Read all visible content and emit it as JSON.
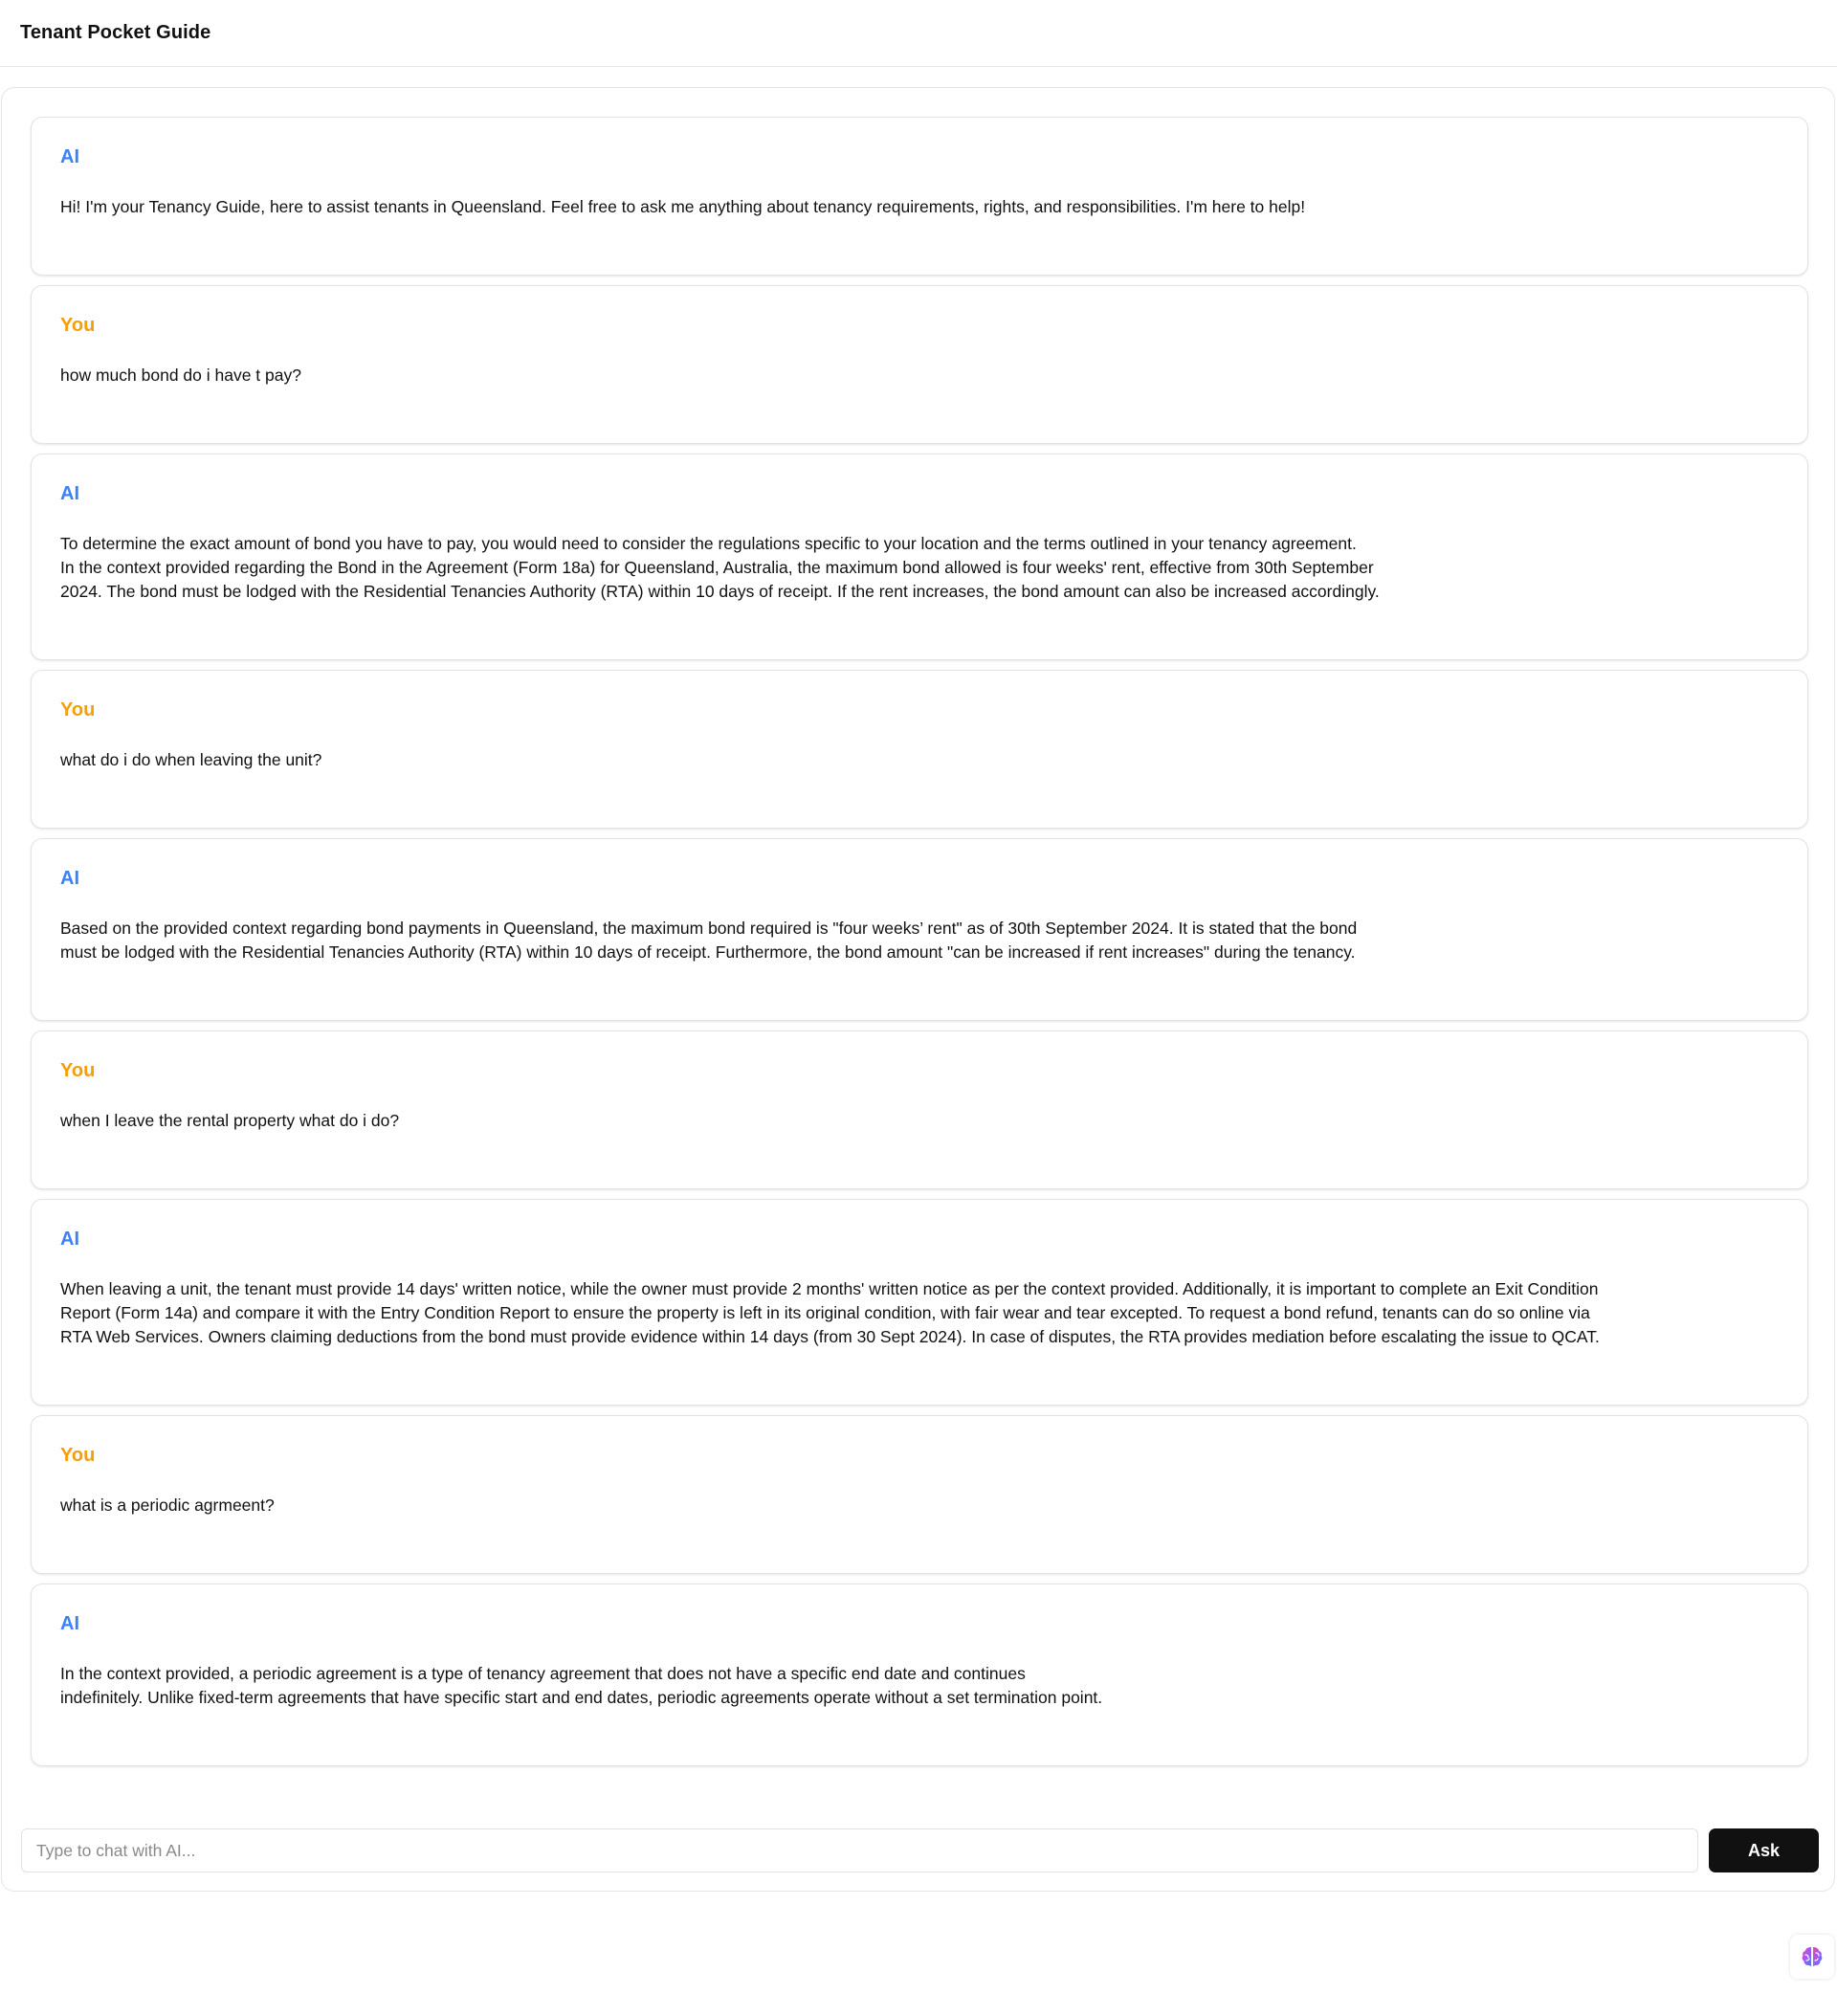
{
  "header": {
    "title": "Tenant Pocket Guide"
  },
  "messages": [
    {
      "sender": "AI",
      "role": "ai",
      "text": "Hi! I'm your Tenancy Guide, here to assist tenants in Queensland. Feel free to ask me anything about tenancy requirements, rights, and responsibilities. I'm here to help!"
    },
    {
      "sender": "You",
      "role": "user",
      "text": "how much bond do i have t pay?"
    },
    {
      "sender": "AI",
      "role": "ai",
      "text": "To determine the exact amount of bond you have to pay, you would need to consider the regulations specific to your location and the terms outlined in your tenancy agreement.\nIn the context provided regarding the Bond in the Agreement (Form 18a) for Queensland, Australia, the maximum bond allowed is four weeks' rent, effective from 30th September\n2024. The bond must be lodged with the Residential Tenancies Authority (RTA) within 10 days of receipt. If the rent increases, the bond amount can also be increased accordingly."
    },
    {
      "sender": "You",
      "role": "user",
      "text": "what do i do when leaving the unit?"
    },
    {
      "sender": "AI",
      "role": "ai",
      "text": "Based on the provided context regarding bond payments in Queensland, the maximum bond required is \"four weeks’ rent\" as of 30th September 2024. It is stated that the bond\nmust be lodged with the Residential Tenancies Authority (RTA) within 10 days of receipt. Furthermore, the bond amount \"can be increased if rent increases\" during the tenancy."
    },
    {
      "sender": "You",
      "role": "user",
      "text": "when I leave the rental property what do i do?"
    },
    {
      "sender": "AI",
      "role": "ai",
      "text": "When leaving a unit, the tenant must provide 14 days' written notice, while the owner must provide 2 months' written notice as per the context provided. Additionally, it is important to complete an Exit Condition\nReport (Form 14a) and compare it with the Entry Condition Report to ensure the property is left in its original condition, with fair wear and tear excepted. To request a bond refund, tenants can do so online via\nRTA Web Services. Owners claiming deductions from the bond must provide evidence within 14 days (from 30 Sept 2024). In case of disputes, the RTA provides mediation before escalating the issue to QCAT."
    },
    {
      "sender": "You",
      "role": "user",
      "text": "what is a periodic agrmeent?"
    },
    {
      "sender": "AI",
      "role": "ai",
      "text": "In the context provided, a periodic agreement is a type of tenancy agreement that does not have a specific end date and continues\nindefinitely. Unlike fixed-term agreements that have specific start and end dates, periodic agreements operate without a set termination point."
    }
  ],
  "composer": {
    "placeholder": "Type to chat with AI...",
    "value": "",
    "ask_label": "Ask"
  },
  "widget": {
    "icon": "brain-icon"
  },
  "colors": {
    "ai_sender": "#3b82f6",
    "user_sender": "#f59e0b",
    "ask_button_bg": "#111111"
  }
}
